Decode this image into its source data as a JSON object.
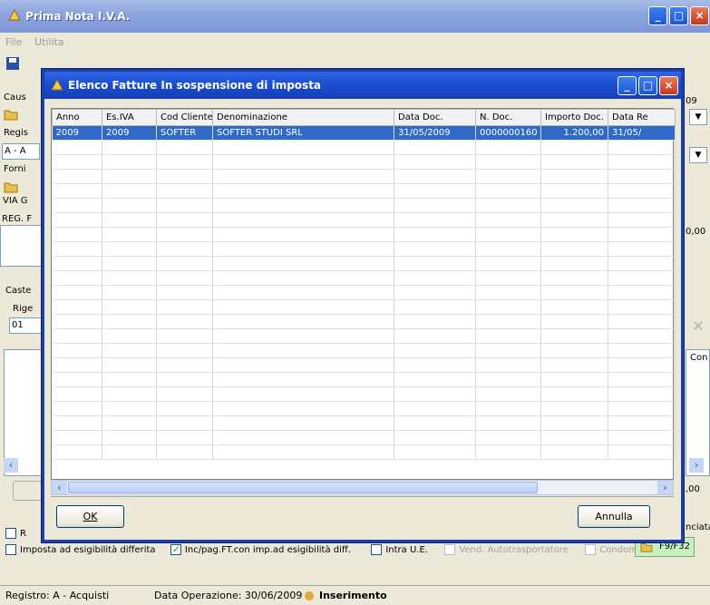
{
  "main_window": {
    "title": "Prima Nota I.V.A.",
    "menu": [
      "File",
      "Utilita"
    ],
    "partial_labels": {
      "causale": "Caus",
      "registro": "Regis",
      "registro_value": "A - A",
      "fornitore": "Forni",
      "via": "VIA G",
      "reg": "REG. F",
      "castelletto": "Caste",
      "righe": "Rige",
      "righe_value": "01",
      "year_partial": "09",
      "amount_partial": "0,00",
      "amount_partial2": ",00",
      "con_col": "Con",
      "annunciata": "nciata"
    },
    "checkboxes": [
      {
        "label": "Imposta ad esigibilità differita",
        "checked": false,
        "disabled": false
      },
      {
        "label": "Inc/pag.FT.con imp.ad esigibilità diff.",
        "checked": true,
        "disabled": false
      },
      {
        "label": "Intra U.E.",
        "checked": false,
        "disabled": false
      },
      {
        "label": "Vend. Autotrasportatore",
        "checked": false,
        "disabled": true
      },
      {
        "label": "Condominio",
        "checked": false,
        "disabled": true
      }
    ],
    "f_button": "F9/F32",
    "status": {
      "registro": "Registro: A - Acquisti",
      "data_operazione": "Data Operazione: 30/06/2009",
      "mode": "Inserimento"
    }
  },
  "dialog": {
    "title": "Elenco Fatture In sospensione di imposta",
    "columns": [
      "Anno",
      "Es.IVA",
      "Cod Cliente",
      "Denominazione",
      "Data Doc.",
      "N. Doc.",
      "Importo Doc.",
      "Data Re"
    ],
    "rows": [
      [
        "2009",
        "2009",
        "SOFTER",
        "SOFTER STUDI SRL",
        "31/05/2009",
        "0000000160",
        "1.200,00",
        "31/05/"
      ]
    ],
    "ok_label": "OK",
    "cancel_label": "Annulla"
  },
  "colors": {
    "titlebar_active": "#1a4bd0",
    "selection": "#3169c6",
    "window_bg": "#ece9d8"
  }
}
